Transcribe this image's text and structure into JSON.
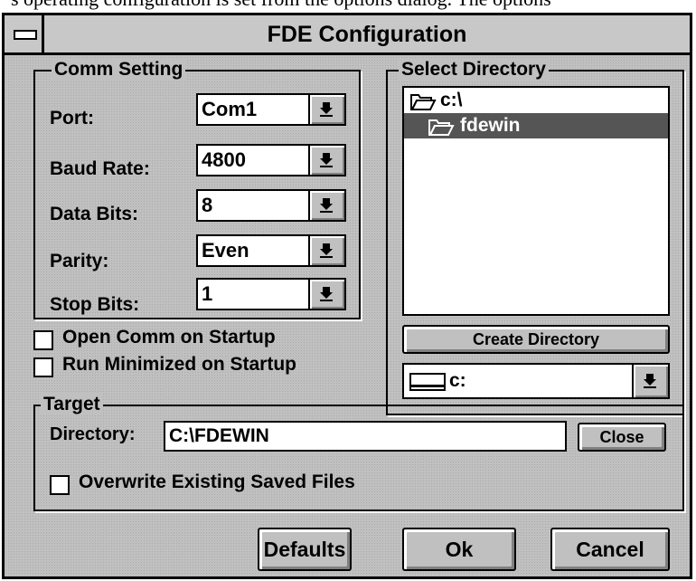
{
  "window": {
    "title": "FDE Configuration"
  },
  "caption_text": "'s operating configuration is set from the options dialog. The options",
  "comm_setting": {
    "legend": "Comm Setting",
    "fields": [
      {
        "label": "Port:",
        "value": "Com1"
      },
      {
        "label": "Baud Rate:",
        "value": "4800"
      },
      {
        "label": "Data Bits:",
        "value": "8"
      },
      {
        "label": "Parity:",
        "value": "Even"
      },
      {
        "label": "Stop Bits:",
        "value": "1"
      }
    ]
  },
  "options": {
    "open_comm": {
      "label": "Open Comm on Startup",
      "checked": false
    },
    "run_minimized": {
      "label": "Run Minimized on Startup",
      "checked": false
    }
  },
  "select_directory": {
    "legend": "Select Directory",
    "items": [
      {
        "label": "c:\\",
        "selected": false
      },
      {
        "label": "fdewin",
        "selected": true
      }
    ],
    "create_button": "Create Directory",
    "drive": "c:"
  },
  "target": {
    "legend": "Target",
    "directory_label": "Directory:",
    "directory_value": "C:\\FDEWIN",
    "close_button": "Close",
    "overwrite_label": "Overwrite Existing Saved Files",
    "overwrite_checked": false
  },
  "buttons": {
    "defaults": "Defaults",
    "ok": "Ok",
    "cancel": "Cancel"
  },
  "colors": {
    "face": "#c0c0c0",
    "selection": "#555555",
    "frame": "#000000"
  }
}
